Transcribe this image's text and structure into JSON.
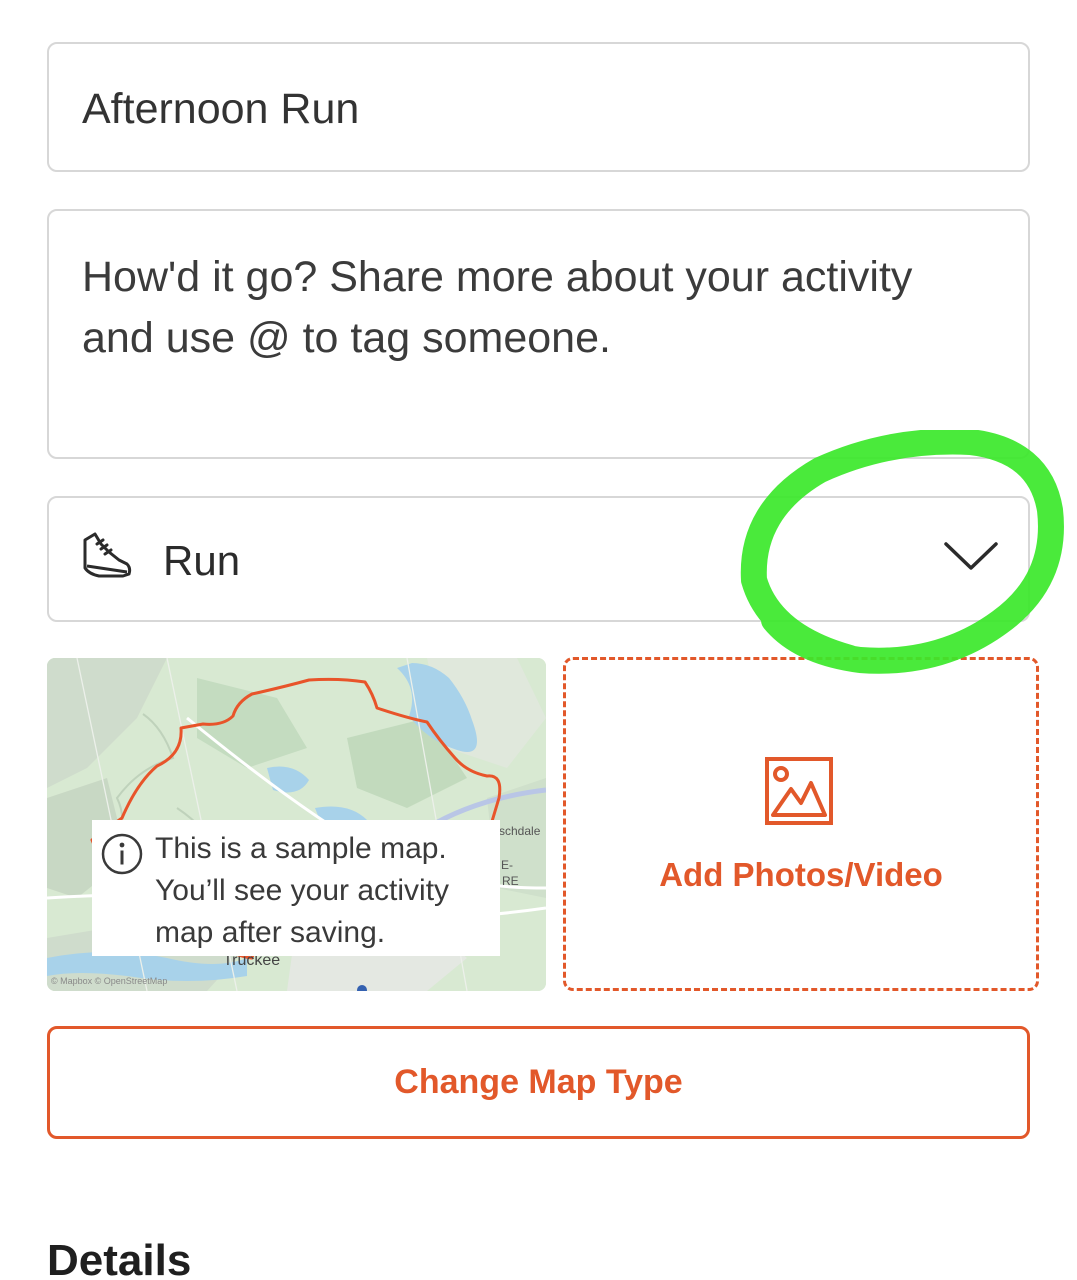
{
  "form": {
    "title_value": "Afternoon Run",
    "description_placeholder": "How'd it go? Share more about your activity and use @ to tag someone.",
    "activity_type": "Run"
  },
  "map": {
    "notice": "This is a sample map. You’ll see your activity map after saving.",
    "label_schdale": "schdale",
    "label_e": "E-",
    "label_re": "RE",
    "label_truckee": "Truckee",
    "attribution": "© Mapbox © OpenStreetMap"
  },
  "media": {
    "add_label": "Add Photos/Video"
  },
  "actions": {
    "change_map_type": "Change Map Type"
  },
  "sections": {
    "details_heading": "Details"
  },
  "colors": {
    "accent": "#e2582a",
    "highlight": "#3be82a",
    "border": "#d7d7d7"
  },
  "icons": [
    "shoe-icon",
    "chevron-down-icon",
    "info-icon",
    "image-icon"
  ]
}
